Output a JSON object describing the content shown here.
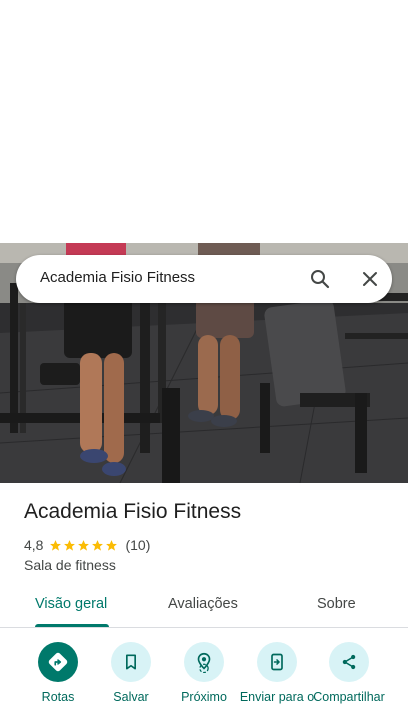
{
  "search": {
    "value": "Academia Fisio Fitness"
  },
  "place": {
    "name": "Academia Fisio Fitness",
    "rating": "4,8",
    "stars": 5,
    "review_count": "(10)",
    "category": "Sala de fitness"
  },
  "tabs": [
    {
      "label": "Visão geral",
      "active": true
    },
    {
      "label": "Avaliações",
      "active": false
    },
    {
      "label": "Sobre",
      "active": false
    }
  ],
  "actions": [
    {
      "label": "Rotas",
      "icon": "directions-icon"
    },
    {
      "label": "Salvar",
      "icon": "bookmark-icon"
    },
    {
      "label": "Próximo",
      "icon": "nearby-icon"
    },
    {
      "label": "Enviar para o",
      "icon": "send-to-phone-icon"
    },
    {
      "label": "Compartilhar",
      "icon": "share-icon"
    }
  ],
  "colors": {
    "accent": "#00796b",
    "action_bg": "#d8f3f6",
    "star": "#fbbc04",
    "text_secondary": "#444746"
  }
}
